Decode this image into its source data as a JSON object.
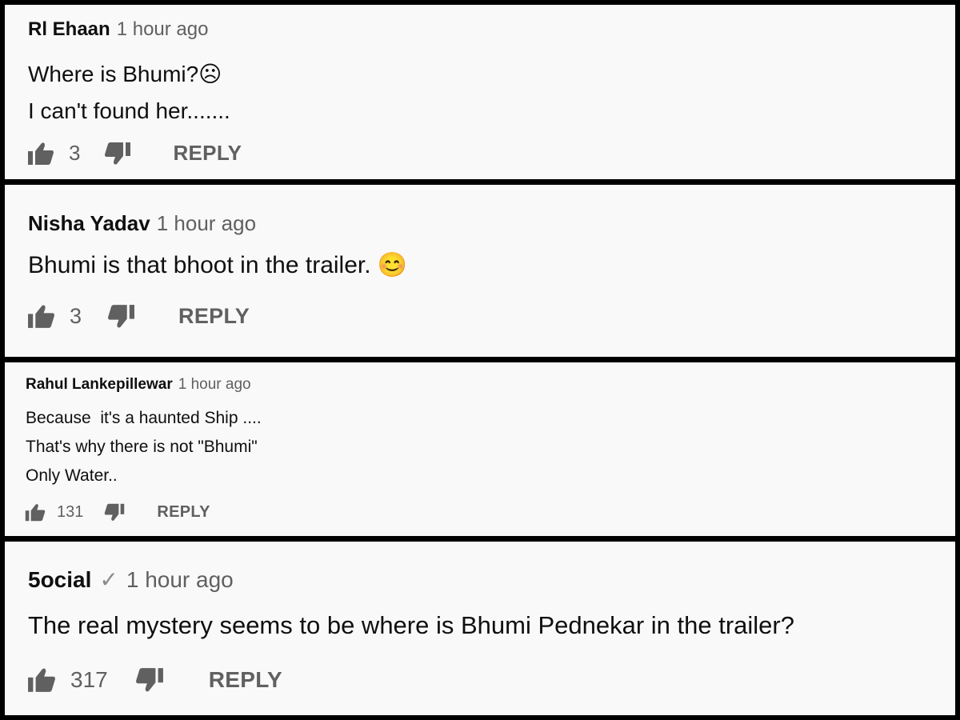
{
  "comments": [
    {
      "author": "Rl Ehaan",
      "time": "1 hour ago",
      "verified": false,
      "lines": [
        "Where is Bhumi?☹",
        "I can't found her......."
      ],
      "likes": "3",
      "reply_label": "REPLY"
    },
    {
      "author": "Nisha Yadav",
      "time": "1 hour ago",
      "verified": false,
      "lines": [
        "Bhumi is that bhoot in the trailer. 😊"
      ],
      "likes": "3",
      "reply_label": "REPLY"
    },
    {
      "author": "Rahul Lankepillewar",
      "time": "1 hour ago",
      "verified": false,
      "lines": [
        "Because  it's a haunted Ship ....",
        "That's why there is not \"Bhumi\"",
        "Only Water.."
      ],
      "likes": "131",
      "reply_label": "REPLY"
    },
    {
      "author": "5ocial",
      "time": "1 hour ago",
      "verified": true,
      "verified_mark": "✓",
      "lines": [
        "The real mystery seems to be where is Bhumi Pednekar in the trailer?"
      ],
      "likes": "317",
      "reply_label": "REPLY"
    }
  ],
  "icons": {
    "like": "thumbs-up-icon",
    "dislike": "thumbs-down-icon",
    "verified": "checkmark-icon"
  },
  "colors": {
    "background": "#f9f9f9",
    "border": "#000000",
    "text": "#0f0f0f",
    "secondary": "#606060"
  }
}
